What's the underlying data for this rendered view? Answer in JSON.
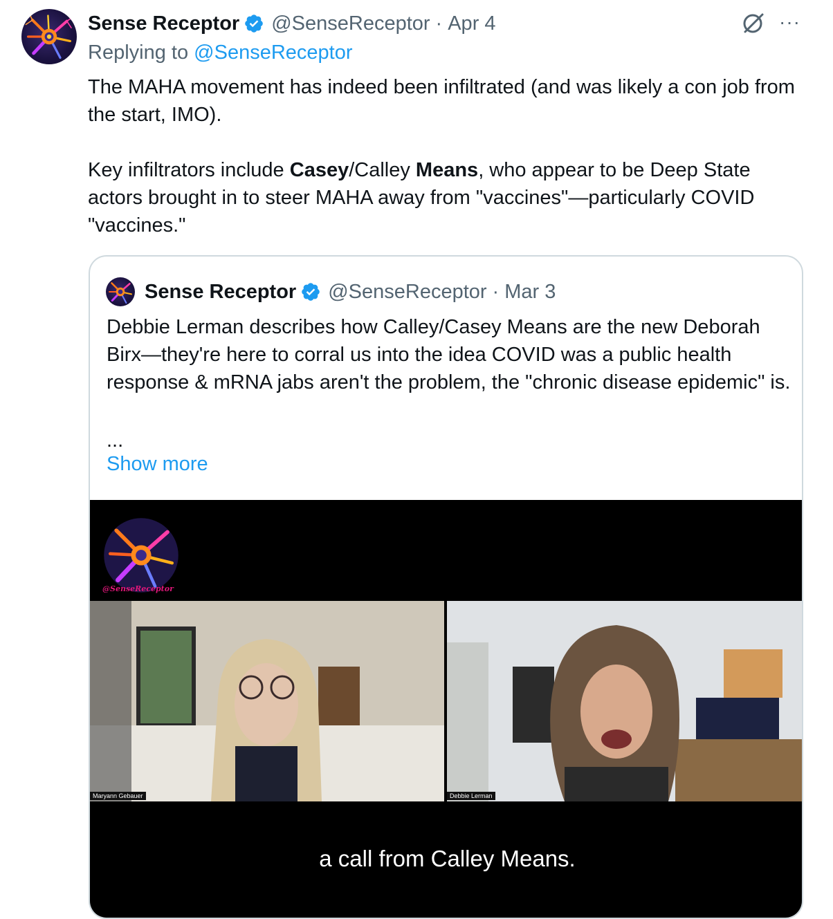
{
  "tweet": {
    "author_name": "Sense Receptor",
    "handle": "@SenseReceptor",
    "separator": "·",
    "date": "Apr 4",
    "replying_prefix": "Replying to",
    "replying_to": "@SenseReceptor",
    "paragraph1": "The MAHA movement has indeed been infiltrated (and was likely a con job from the start, IMO).",
    "paragraph2": {
      "t1": "Key infiltrators include ",
      "b1": "Casey",
      "t2": "/Calley ",
      "b2": "Means",
      "t3": ", who appear to be Deep State actors brought in to steer MAHA away from \"vaccines\"—particularly COVID \"vaccines.\""
    },
    "more_label": "···"
  },
  "quote": {
    "author_name": "Sense Receptor",
    "handle": "@SenseReceptor",
    "separator": "·",
    "date": "Mar 3",
    "text": "Debbie Lerman describes how Calley/Casey Means are the new Deborah Birx—they're here to corral us into the idea COVID was a public health response & mRNA jabs aren't the problem, the \"chronic disease epidemic\" is.",
    "ellipsis": "...",
    "show_more": "Show more",
    "video": {
      "watermark": "@SenseReceptor",
      "left_participant": "Maryann Gebauer",
      "right_participant": "Debbie Lerman",
      "caption": "a call from Calley Means."
    }
  },
  "colors": {
    "accent": "#1d9bf0",
    "text": "#0f1419",
    "secondary": "#536471",
    "border": "#cfd9de"
  },
  "icons": {
    "verified": "verified-badge-icon",
    "grok": "grok-icon",
    "more": "more-options-icon"
  }
}
